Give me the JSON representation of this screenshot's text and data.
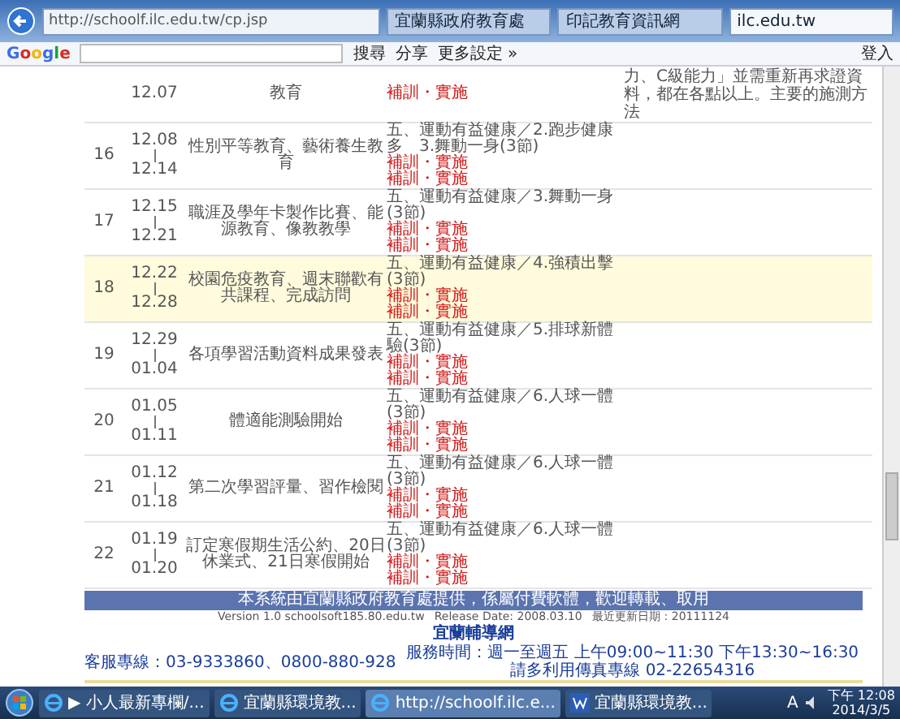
{
  "browser": {
    "address": "http://schoolf.ilc.edu.tw/cp.jsp",
    "tabs": [
      {
        "label": "宜蘭縣政府教育處",
        "selected": false
      },
      {
        "label": "印記教育資訊網",
        "selected": false
      },
      {
        "label": "ilc.edu.tw",
        "selected": true
      }
    ],
    "toolbar": {
      "brand": "Google",
      "buttons": [
        "搜尋",
        "分享",
        "更多設定 »"
      ],
      "signin": "登入"
    }
  },
  "partial_row": {
    "date": "12.07",
    "topic": "教育",
    "marks": [
      "補訓・實施"
    ],
    "note": "力、C級能力」並需重新再求證資料，都在各點以上。主要的施測方法"
  },
  "rows": [
    {
      "week": "16",
      "start": "12.08",
      "end": "12.14",
      "topic": "性別平等教育、藝術養生教育",
      "activity": "五、運動有益健康／2.跑步健康多　3.舞動一身(3節)",
      "marks": [
        "補訓・實施",
        "補訓・實施"
      ],
      "highlighted": false
    },
    {
      "week": "17",
      "start": "12.15",
      "end": "12.21",
      "topic": "職涯及學年卡製作比賽、能源教育、像教教學",
      "activity": "五、運動有益健康／3.舞動一身(3節)",
      "marks": [
        "補訓・實施",
        "補訓・實施"
      ],
      "highlighted": false
    },
    {
      "week": "18",
      "start": "12.22",
      "end": "12.28",
      "topic": "校園危疫教育、週末聯歡有共課程、完成訪問",
      "activity": "五、運動有益健康／4.強積出擊(3節)",
      "marks": [
        "補訓・實施",
        "補訓・實施"
      ],
      "highlighted": true
    },
    {
      "week": "19",
      "start": "12.29",
      "end": "01.04",
      "topic": "各項學習活動資料成果發表",
      "activity": "五、運動有益健康／5.排球新體驗(3節)",
      "marks": [
        "補訓・實施",
        "補訓・實施"
      ],
      "highlighted": false
    },
    {
      "week": "20",
      "start": "01.05",
      "end": "01.11",
      "topic": "體適能測驗開始",
      "activity": "五、運動有益健康／6.人球一體(3節)",
      "marks": [
        "補訓・實施",
        "補訓・實施"
      ],
      "highlighted": false
    },
    {
      "week": "21",
      "start": "01.12",
      "end": "01.18",
      "topic": "第二次學習評量、習作檢閱",
      "activity": "五、運動有益健康／6.人球一體(3節)",
      "marks": [
        "補訓・實施",
        "補訓・實施"
      ],
      "highlighted": false
    },
    {
      "week": "22",
      "start": "01.19",
      "end": "01.20",
      "topic": "訂定寒假期生活公約、20日休業式、21日寒假開始",
      "activity": "五、運動有益健康／6.人球一體(3節)",
      "marks": [
        "補訓・實施",
        "補訓・實施"
      ],
      "highlighted": false
    }
  ],
  "footer": {
    "banner": "本系統由宜蘭縣政府教育處提供，係屬付費軟體，歡迎轉載、取用",
    "version": "Version 1.0 schoolsoft185.80.edu.tw",
    "release": "Release Date: 2008.03.10",
    "updated": "最近更新日期：20111124",
    "site": "宜蘭輔導網",
    "hotline": "客服專線：03-9333860、0800-880-928",
    "hours": "服務時間：週一至週五 上午09:00~11:30 下午13:30~16:30 請多利用傳真專線 02-22654316"
  },
  "taskbar": {
    "items": [
      {
        "label": "▶ 小人最新專欄/...",
        "kind": "ie",
        "selected": false
      },
      {
        "label": "宜蘭縣環境教...",
        "kind": "ie",
        "selected": false
      },
      {
        "label": "http://schoolf.ilc.e...",
        "kind": "ie",
        "selected": true
      },
      {
        "label": "宜蘭縣環境教...",
        "kind": "word",
        "selected": false
      }
    ],
    "tray": "A",
    "time": "下午 12:08",
    "date": "2014/3/5"
  }
}
